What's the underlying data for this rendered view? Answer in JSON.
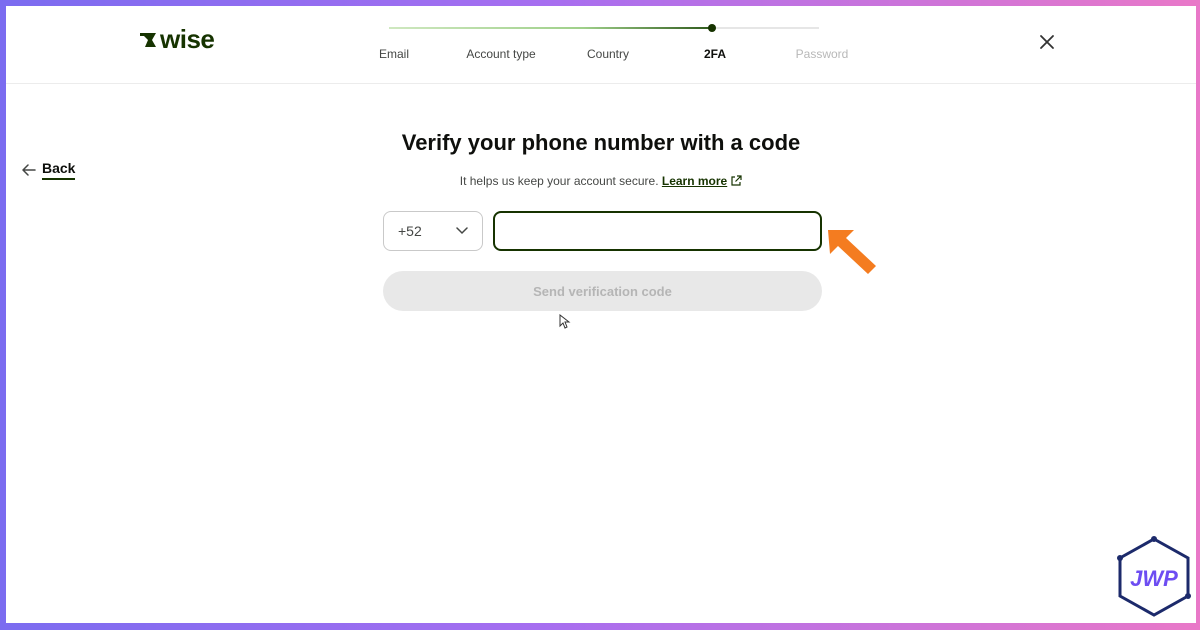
{
  "brand": {
    "logo_text": "WISE",
    "logo_icon": "wise-flag-icon",
    "brand_color": "#163300"
  },
  "stepper": {
    "steps": [
      {
        "label": "Email",
        "state": "done"
      },
      {
        "label": "Account type",
        "state": "done"
      },
      {
        "label": "Country",
        "state": "done"
      },
      {
        "label": "2FA",
        "state": "current"
      },
      {
        "label": "Password",
        "state": "upcoming"
      }
    ],
    "progress": 0.75
  },
  "nav": {
    "back_label": "Back",
    "back_icon": "arrow-left-icon",
    "close_icon": "close-icon"
  },
  "main": {
    "title": "Verify your phone number with a code",
    "subtitle": "It helps us keep your account secure.",
    "learn_more": "Learn more",
    "learn_more_icon": "external-link-icon",
    "country_code": "+52",
    "phone_value": "",
    "send_button": "Send verification code",
    "send_enabled": false
  },
  "annotations": {
    "pointer_arrow_color": "#f47c20",
    "watermark": "JWP"
  }
}
